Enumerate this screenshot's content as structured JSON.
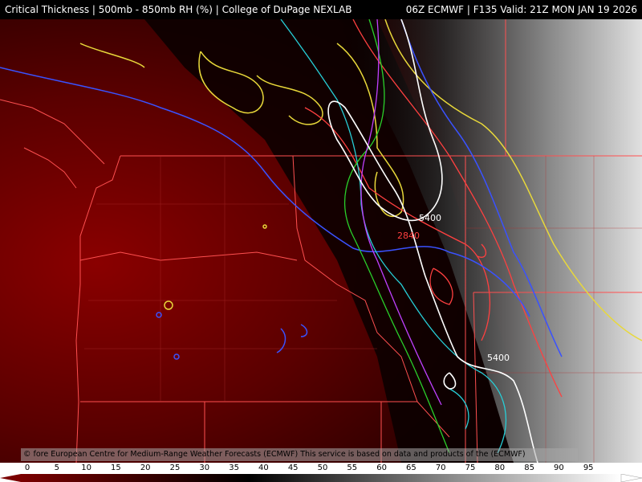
{
  "header": {
    "title": "Critical Thickness | 500mb - 850mb RH (%) | College of DuPage NEXLAB",
    "valid_info": "06Z ECMWF | F135 Valid: 21Z MON JAN 19 2026"
  },
  "map": {
    "contour_labels": [
      "5400",
      "2840",
      "5400"
    ],
    "contour_colors": {
      "white": "#ffffff",
      "blue": "#3a52ff",
      "red": "#ff4040",
      "yellow": "#e8d83a",
      "cyan": "#27cfd8",
      "green": "#2ad12a",
      "magenta": "#c040ff"
    },
    "border_color": "#ff5050"
  },
  "credit": {
    "text": "© fore European Centre for Medium-Range Weather Forecasts (ECMWF)  This service is based on data and products of the (ECMWF)"
  },
  "colorbar": {
    "ticks": [
      "0",
      "5",
      "10",
      "15",
      "20",
      "25",
      "30",
      "35",
      "40",
      "45",
      "50",
      "55",
      "60",
      "65",
      "70",
      "75",
      "80",
      "85",
      "90",
      "95"
    ],
    "min_color": "#7a0000",
    "mid_color": "#000000",
    "max_color": "#ffffff"
  }
}
